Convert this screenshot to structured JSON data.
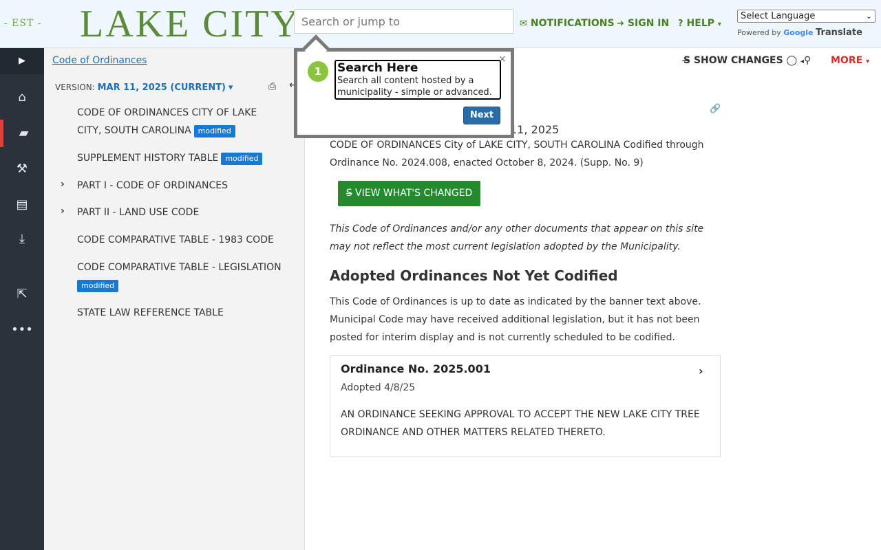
{
  "header": {
    "logo_est": "- EST -",
    "logo_name": "LAKE CITY",
    "search_placeholder": "Search or jump to",
    "notifications": "NOTIFICATIONS",
    "sign_in": "SIGN IN",
    "help": "HELP",
    "language_select": "Select Language",
    "powered_by": "Powered by",
    "google": "Google",
    "translate": "Translate"
  },
  "toc": {
    "breadcrumb": "Code of Ordinances",
    "version_label": "VERSION:",
    "version_value": "MAR 11, 2025 (CURRENT)",
    "items": [
      {
        "label": "CODE OF ORDINANCES CITY OF LAKE CITY, SOUTH CAROLINA",
        "badge": "modified"
      },
      {
        "label": "SUPPLEMENT HISTORY TABLE",
        "badge": "modified"
      },
      {
        "label": "PART I - CODE OF ORDINANCES",
        "badge": ""
      },
      {
        "label": "PART II - LAND USE CODE",
        "badge": ""
      },
      {
        "label": "CODE COMPARATIVE TABLE - 1983 CODE",
        "badge": ""
      },
      {
        "label": "CODE COMPARATIVE TABLE - LEGISLATION",
        "badge": "modified"
      },
      {
        "label": "STATE LAW REFERENCE TABLE",
        "badge": ""
      }
    ]
  },
  "main": {
    "show_changes": "SHOW CHANGES",
    "more": "MORE",
    "date_fragment": "11, 2025",
    "codified_line1": "CODE OF ORDINANCES City of LAKE CITY, SOUTH CAROLINA Codified through",
    "codified_line2": "Ordinance No. 2024.008, enacted October 8, 2024. (Supp. No. 9)",
    "view_changed": "VIEW WHAT'S CHANGED",
    "disclaimer": "This Code of Ordinances and/or any other documents that appear on this site may not reflect the most current legislation adopted by the Municipality.",
    "adopted_heading": "Adopted Ordinances Not Yet Codified",
    "adopted_para": "This Code of Ordinances is up to date as indicated by the banner text above. Municipal Code may have received additional legislation, but it has not been posted for interim display and is not currently scheduled to be codified.",
    "ordinance": {
      "title": "Ordinance No. 2025.001",
      "adopted": "Adopted 4/8/25",
      "description": "AN ORDINANCE SEEKING APPROVAL TO ACCEPT THE NEW LAKE CITY TREE ORDINANCE AND OTHER MATTERS RELATED THERETO."
    }
  },
  "tour": {
    "step": "1",
    "title": "Search Here",
    "text": "Search all content hosted by a municipality - simple or advanced.",
    "close": "×",
    "next": "Next"
  },
  "colors": {
    "brand_green": "#4a7f27",
    "link_blue": "#1c6fb8",
    "badge_blue": "#1779d6",
    "button_green": "#238a2e",
    "rail_dark": "#2a323b",
    "more_red": "#d0312d"
  },
  "icons": {
    "notifications": "envelope-icon",
    "sign_in": "sign-in-icon",
    "help": "question-circle-icon",
    "rail": [
      "chevron-right-icon",
      "home-icon",
      "book-icon",
      "gavel-icon",
      "document-icon",
      "download-icon",
      "external-link-icon",
      "ellipsis-icon"
    ]
  }
}
